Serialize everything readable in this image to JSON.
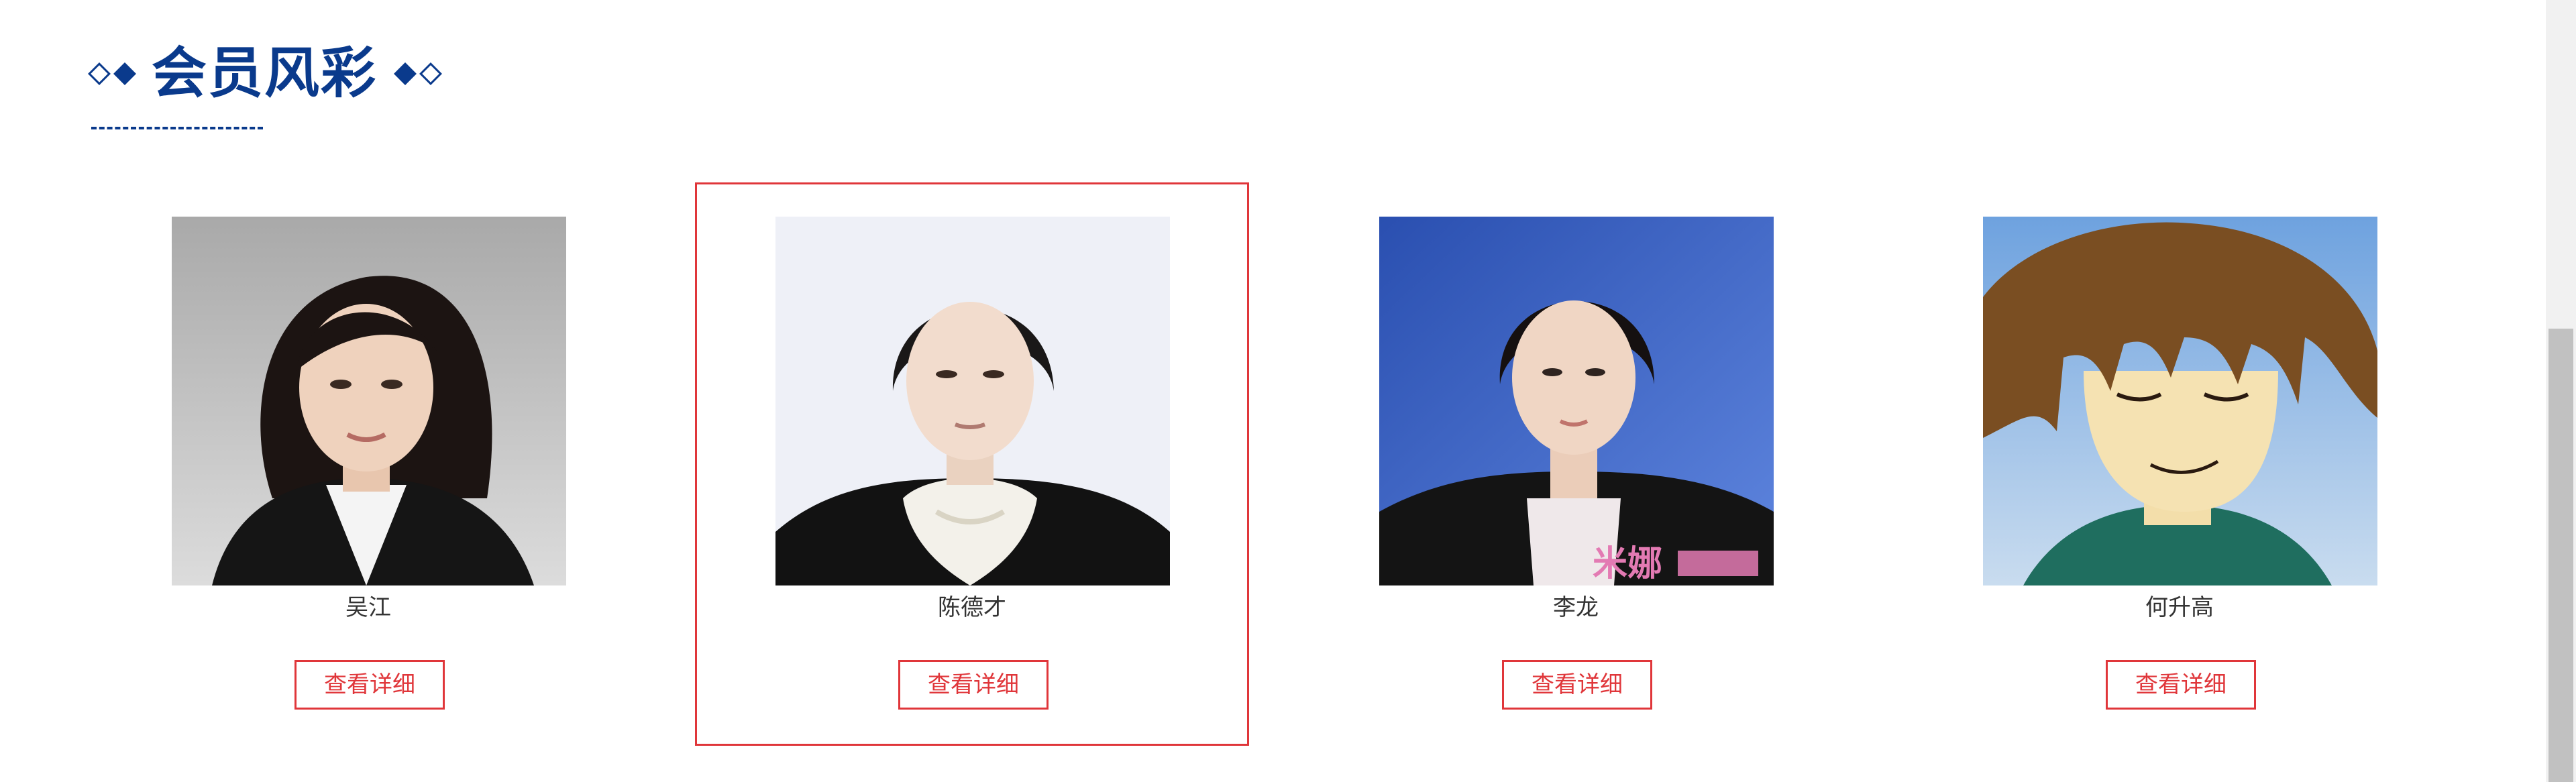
{
  "section": {
    "title": "会员风彩"
  },
  "members": [
    {
      "name": "吴江",
      "button_label": "查看详细",
      "selected": false
    },
    {
      "name": "陈德才",
      "button_label": "查看详细",
      "selected": true
    },
    {
      "name": "李龙",
      "button_label": "查看详细",
      "selected": false,
      "photo_watermark": "米娜"
    },
    {
      "name": "何升高",
      "button_label": "查看详细",
      "selected": false
    }
  ],
  "colors": {
    "primary": "#0a3a8c",
    "accent": "#e0363a",
    "text": "#333333"
  }
}
